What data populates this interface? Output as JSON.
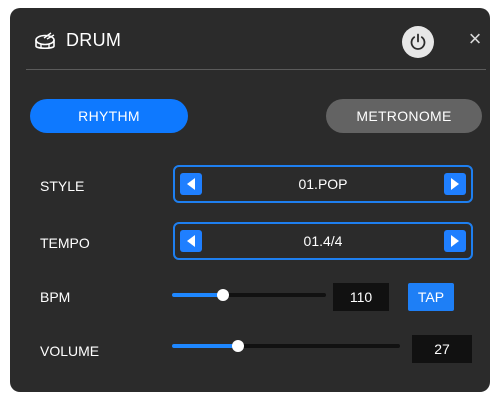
{
  "header": {
    "title": "DRUM",
    "drum_icon": "drum-icon",
    "power_icon": "power-icon",
    "close_label": "×"
  },
  "modes": {
    "rhythm_label": "RHYTHM",
    "metronome_label": "METRONOME",
    "active": "RHYTHM"
  },
  "style": {
    "label": "STYLE",
    "value": "01.POP"
  },
  "tempo": {
    "label": "TEMPO",
    "value": "01.4/4"
  },
  "bpm": {
    "label": "BPM",
    "value": "110",
    "level_percent": 33,
    "tap_label": "TAP"
  },
  "volume": {
    "label": "VOLUME",
    "value": "27",
    "level_percent": 29
  },
  "colors": {
    "accent": "#0e79ff",
    "panel": "#2b2b2b",
    "inactive_button": "#636363",
    "value_box": "#111111"
  }
}
